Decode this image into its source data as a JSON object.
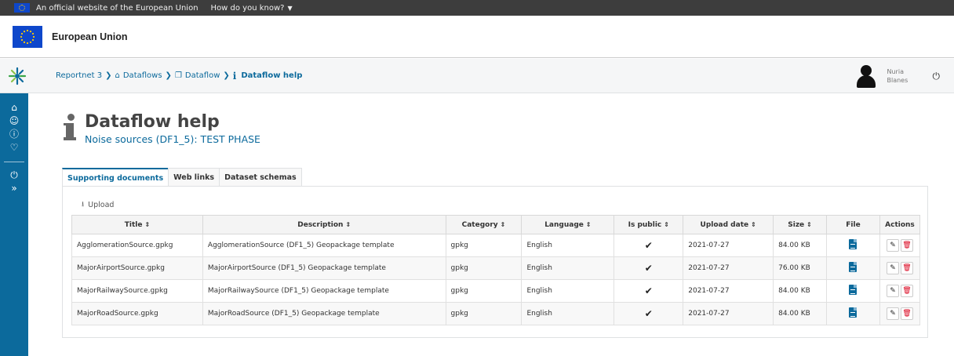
{
  "eu_banner": {
    "official_text": "An official website of the European Union",
    "how_text": "How do you know?",
    "caret_icon": "chevron-down-icon"
  },
  "eu_header": {
    "label": "European Union"
  },
  "reportnet_bar": {
    "breadcrumb": [
      {
        "label": "Reportnet 3",
        "icon": ""
      },
      {
        "label": "Dataflows",
        "icon": "home-icon"
      },
      {
        "label": "Dataflow",
        "icon": "clone-icon"
      },
      {
        "label": "Dataflow help",
        "icon": "info-icon"
      }
    ],
    "user": {
      "first_name": "Nuria",
      "last_name": "Blanes"
    }
  },
  "sidebar": {
    "icons": [
      "home-icon",
      "user-icon",
      "help-icon",
      "bell-icon",
      "power-icon",
      "expand-icon"
    ]
  },
  "page": {
    "title": "Dataflow help",
    "subtitle": "Noise sources (DF1_5): TEST PHASE"
  },
  "tabs": [
    {
      "label": "Supporting documents",
      "active": true
    },
    {
      "label": "Web links",
      "active": false
    },
    {
      "label": "Dataset schemas",
      "active": false
    }
  ],
  "upload_label": "Upload",
  "table": {
    "columns": [
      "Title",
      "Description",
      "Category",
      "Language",
      "Is public",
      "Upload date",
      "Size",
      "File",
      "Actions"
    ],
    "rows": [
      {
        "title": "AgglomerationSource.gpkg",
        "description": "AgglomerationSource (DF1_5) Geopackage template",
        "category": "gpkg",
        "language": "English",
        "is_public": true,
        "upload_date": "2021-07-27",
        "size": "84.00 KB"
      },
      {
        "title": "MajorAirportSource.gpkg",
        "description": "MajorAirportSource (DF1_5) Geopackage template",
        "category": "gpkg",
        "language": "English",
        "is_public": true,
        "upload_date": "2021-07-27",
        "size": "76.00 KB"
      },
      {
        "title": "MajorRailwaySource.gpkg",
        "description": "MajorRailwaySource (DF1_5) Geopackage template",
        "category": "gpkg",
        "language": "English",
        "is_public": true,
        "upload_date": "2021-07-27",
        "size": "84.00 KB"
      },
      {
        "title": "MajorRoadSource.gpkg",
        "description": "MajorRoadSource (DF1_5) Geopackage template",
        "category": "gpkg",
        "language": "English",
        "is_public": true,
        "upload_date": "2021-07-27",
        "size": "84.00 KB"
      }
    ]
  },
  "colors": {
    "primary": "#0c6a9c",
    "delete": "#d9001b",
    "eu_blue": "#0e47cb",
    "top_bar": "#3d3d3d"
  }
}
